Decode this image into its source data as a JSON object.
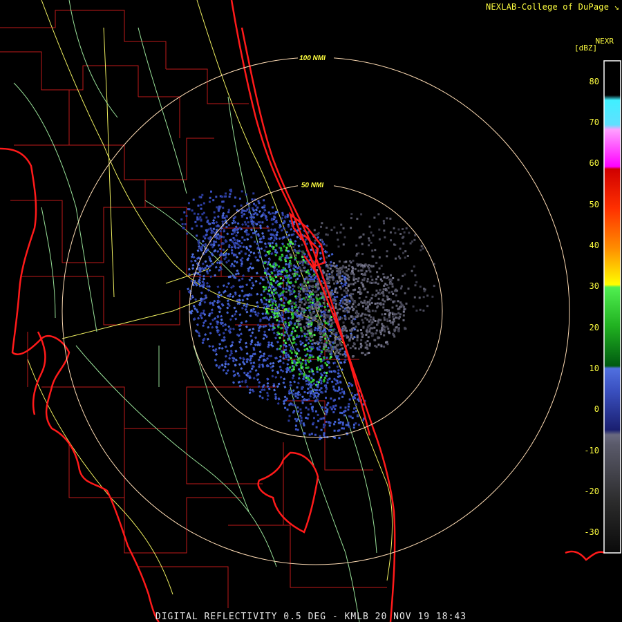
{
  "header": {
    "credit": "NEXLAB-College of DuPage",
    "credit_icon": "tilted-arrow-icon"
  },
  "footer": {
    "product_line": "DIGITAL REFLECTIVITY 0.5 DEG - KMLB 20 NOV 19 18:43"
  },
  "range_rings": [
    {
      "label": "50 NMI",
      "color": "#ffdcb4"
    },
    {
      "label": "100 NMI",
      "color": "#ffdcb4"
    }
  ],
  "legend": {
    "product": "NEXR",
    "unit": "[dBZ]",
    "ticks": [
      "80",
      "70",
      "60",
      "50",
      "40",
      "30",
      "20",
      "10",
      "0",
      "-10",
      "-20",
      "-30"
    ],
    "range_dbz": [
      -35,
      85
    ]
  },
  "colors": {
    "coastline": "#ff1a1a",
    "county_lines": "#c01a1a",
    "highways": "#f0f060",
    "roads": "#98e098",
    "text": "#ffff40"
  }
}
